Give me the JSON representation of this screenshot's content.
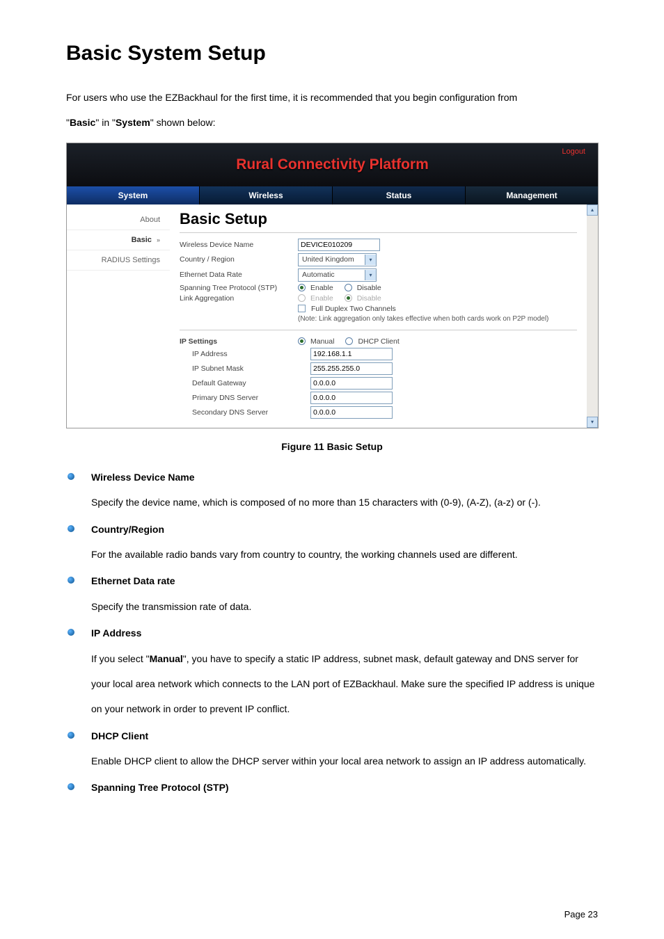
{
  "page": {
    "title": "Basic System Setup",
    "intro_line1": "For users who use the EZBackhaul for the first time, it is recommended that you begin configuration from",
    "intro_line2_pre": "\"",
    "intro_line2_b1": "Basic",
    "intro_line2_mid": "\" in \"",
    "intro_line2_b2": "System",
    "intro_line2_post": "\" shown below:",
    "figure_caption": "Figure 11 Basic Setup",
    "footer": "Page 23"
  },
  "shot": {
    "brand": "Rural Connectivity Platform",
    "logout": "Logout",
    "tabs": {
      "system": "System",
      "wireless": "Wireless",
      "status": "Status",
      "mgmt": "Management"
    },
    "sidebar": {
      "about": "About",
      "basic": "Basic",
      "basic_arrow": "»",
      "radius": "RADIUS Settings"
    },
    "panel": {
      "heading": "Basic Setup",
      "rows": {
        "wdn_label": "Wireless Device Name",
        "wdn_value": "DEVICE010209",
        "cr_label": "Country / Region",
        "cr_value": "United Kingdom",
        "edr_label": "Ethernet Data Rate",
        "edr_value": "Automatic",
        "stp_label": "Spanning Tree Protocol (STP)",
        "stp_enable": "Enable",
        "stp_disable": "Disable",
        "la_label": "Link Aggregation",
        "la_enable": "Enable",
        "la_disable": "Disable",
        "fd_label": "Full Duplex Two Channels",
        "note": "(Note: Link aggregation only takes effective when both cards work on P2P model)",
        "ip_section": "IP Settings",
        "ip_manual": "Manual",
        "ip_dhcp": "DHCP Client",
        "ipaddr_label": "IP Address",
        "ipaddr_value": "192.168.1.1",
        "subnet_label": "IP Subnet Mask",
        "subnet_value": "255.255.255.0",
        "gw_label": "Default Gateway",
        "gw_value": "0.0.0.0",
        "pdns_label": "Primary DNS Server",
        "pdns_value": "0.0.0.0",
        "sdns_label": "Secondary DNS Server",
        "sdns_value": "0.0.0.0"
      }
    }
  },
  "defs": {
    "wdn_t": "Wireless Device Name",
    "wdn_d": "Specify the device name, which is composed of no more than 15 characters with (0-9), (A-Z), (a-z) or (-).",
    "cr_t": "Country/Region",
    "cr_d": "For the available radio bands vary from country to country, the working channels used are different.",
    "edr_t": "Ethernet Data rate",
    "edr_d": "Specify the transmission rate of data.",
    "ip_t": "IP Address",
    "ip_d_pre": "If you select \"",
    "ip_d_b": "Manual",
    "ip_d_post": "\", you have to specify a static IP address, subnet mask, default gateway and DNS server for your local area network which connects to the LAN port of EZBackhaul.   Make sure the specified IP address is unique on your network in order to prevent IP conflict.",
    "dhcp_t": "DHCP Client",
    "dhcp_d": "Enable DHCP client to allow the DHCP server within your local area network to assign an IP address automatically.",
    "stp_t": "Spanning Tree Protocol (STP)"
  }
}
